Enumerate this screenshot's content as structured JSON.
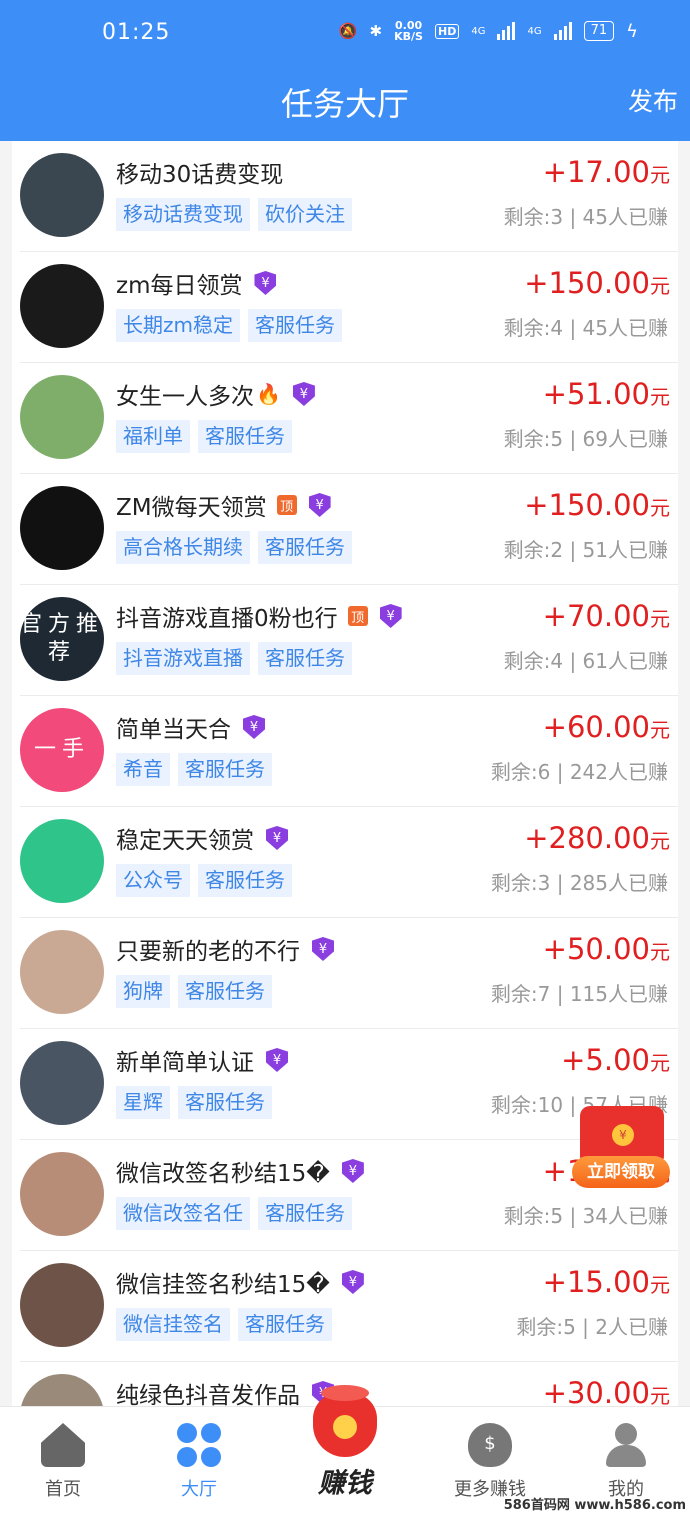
{
  "status": {
    "time": "01:25",
    "net_speed": "0.00",
    "net_unit": "KB/S",
    "hd": "HD",
    "sig1": "4G",
    "sig2": "4G",
    "battery": "71"
  },
  "header": {
    "title": "任务大厅",
    "publish": "发布"
  },
  "tasks": [
    {
      "title": "移动30话费变现",
      "tags": [
        "移动话费变现",
        "砍价关注"
      ],
      "price": "+17.00",
      "unit": "元",
      "meta": "剩余:3 | 45人已赚",
      "avatar_color": "#3b4750"
    },
    {
      "title": "zm每日领赏",
      "tags": [
        "长期zm稳定",
        "客服任务"
      ],
      "price": "+150.00",
      "unit": "元",
      "meta": "剩余:4 | 45人已赚",
      "avatar_color": "#1a1a1a"
    },
    {
      "title": "女生一人多次",
      "tags": [
        "福利单",
        "客服任务"
      ],
      "price": "+51.00",
      "unit": "元",
      "meta": "剩余:5 | 69人已赚",
      "avatar_color": "#7fae6a"
    },
    {
      "title": "ZM微每天领赏",
      "tags": [
        "高合格长期续",
        "客服任务"
      ],
      "price": "+150.00",
      "unit": "元",
      "meta": "剩余:2 | 51人已赚",
      "avatar_color": "#111111"
    },
    {
      "title": "抖音游戏直播0粉也行",
      "tags": [
        "抖音游戏直播",
        "客服任务"
      ],
      "price": "+70.00",
      "unit": "元",
      "meta": "剩余:4 | 61人已赚",
      "avatar_color": "#1f2933",
      "avatar_text": "官方推荐"
    },
    {
      "title": "简单当天合",
      "tags": [
        "希音",
        "客服任务"
      ],
      "price": "+60.00",
      "unit": "元",
      "meta": "剩余:6 | 242人已赚",
      "avatar_color": "#f24a7a",
      "avatar_text": "一手"
    },
    {
      "title": "稳定天天领赏",
      "tags": [
        "公众号",
        "客服任务"
      ],
      "price": "+280.00",
      "unit": "元",
      "meta": "剩余:3 | 285人已赚",
      "avatar_color": "#2fc48a"
    },
    {
      "title": "只要新的老的不行",
      "tags": [
        "狗牌",
        "客服任务"
      ],
      "price": "+50.00",
      "unit": "元",
      "meta": "剩余:7 | 115人已赚",
      "avatar_color": "#c9a993"
    },
    {
      "title": "新单简单认证",
      "tags": [
        "星辉",
        "客服任务"
      ],
      "price": "+5.00",
      "unit": "元",
      "meta": "剩余:10 | 57人已赚",
      "avatar_color": "#4a5564"
    },
    {
      "title": "微信改签名秒结15�",
      "tags": [
        "微信改签名任",
        "客服任务"
      ],
      "price": "+15.00",
      "unit": "元",
      "meta": "剩余:5 | 34人已赚",
      "avatar_color": "#b88d78"
    },
    {
      "title": "微信挂签名秒结15�",
      "tags": [
        "微信挂签名",
        "客服任务"
      ],
      "price": "+15.00",
      "unit": "元",
      "meta": "剩余:5 | 2人已赚",
      "avatar_color": "#6e5448"
    },
    {
      "title": "纯绿色抖音发作品",
      "tags": [],
      "price": "+30.00",
      "unit": "元",
      "meta": "",
      "avatar_color": "#9a8a7a"
    }
  ],
  "task_badges": [
    {
      "top": false,
      "verified": false,
      "fire": false
    },
    {
      "top": false,
      "verified": true,
      "fire": false
    },
    {
      "top": false,
      "verified": true,
      "fire": true
    },
    {
      "top": true,
      "verified": true,
      "fire": false
    },
    {
      "top": true,
      "verified": true,
      "fire": false
    },
    {
      "top": false,
      "verified": true,
      "fire": false
    },
    {
      "top": false,
      "verified": true,
      "fire": false
    },
    {
      "top": false,
      "verified": true,
      "fire": false
    },
    {
      "top": false,
      "verified": true,
      "fire": false
    },
    {
      "top": false,
      "verified": true,
      "fire": false
    },
    {
      "top": false,
      "verified": true,
      "fire": false
    },
    {
      "top": false,
      "verified": true,
      "fire": false
    }
  ],
  "badge_text": {
    "verified": "¥",
    "top": "顶",
    "fire": "🔥",
    "coin": "¥"
  },
  "redpacket": {
    "label": "立即领取"
  },
  "tabbar": {
    "home": "首页",
    "hall": "大厅",
    "earn": "赚钱",
    "more": "更多赚钱",
    "mine": "我的"
  },
  "watermark": "586首码网 www.h586.com"
}
